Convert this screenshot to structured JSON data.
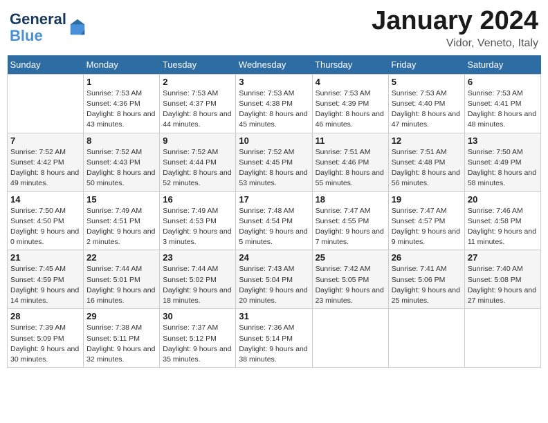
{
  "header": {
    "logo_line1": "General",
    "logo_line2": "Blue",
    "month": "January 2024",
    "location": "Vidor, Veneto, Italy"
  },
  "weekdays": [
    "Sunday",
    "Monday",
    "Tuesday",
    "Wednesday",
    "Thursday",
    "Friday",
    "Saturday"
  ],
  "weeks": [
    [
      {
        "day": "",
        "sunrise": "",
        "sunset": "",
        "daylight": ""
      },
      {
        "day": "1",
        "sunrise": "Sunrise: 7:53 AM",
        "sunset": "Sunset: 4:36 PM",
        "daylight": "Daylight: 8 hours and 43 minutes."
      },
      {
        "day": "2",
        "sunrise": "Sunrise: 7:53 AM",
        "sunset": "Sunset: 4:37 PM",
        "daylight": "Daylight: 8 hours and 44 minutes."
      },
      {
        "day": "3",
        "sunrise": "Sunrise: 7:53 AM",
        "sunset": "Sunset: 4:38 PM",
        "daylight": "Daylight: 8 hours and 45 minutes."
      },
      {
        "day": "4",
        "sunrise": "Sunrise: 7:53 AM",
        "sunset": "Sunset: 4:39 PM",
        "daylight": "Daylight: 8 hours and 46 minutes."
      },
      {
        "day": "5",
        "sunrise": "Sunrise: 7:53 AM",
        "sunset": "Sunset: 4:40 PM",
        "daylight": "Daylight: 8 hours and 47 minutes."
      },
      {
        "day": "6",
        "sunrise": "Sunrise: 7:53 AM",
        "sunset": "Sunset: 4:41 PM",
        "daylight": "Daylight: 8 hours and 48 minutes."
      }
    ],
    [
      {
        "day": "7",
        "sunrise": "Sunrise: 7:52 AM",
        "sunset": "Sunset: 4:42 PM",
        "daylight": "Daylight: 8 hours and 49 minutes."
      },
      {
        "day": "8",
        "sunrise": "Sunrise: 7:52 AM",
        "sunset": "Sunset: 4:43 PM",
        "daylight": "Daylight: 8 hours and 50 minutes."
      },
      {
        "day": "9",
        "sunrise": "Sunrise: 7:52 AM",
        "sunset": "Sunset: 4:44 PM",
        "daylight": "Daylight: 8 hours and 52 minutes."
      },
      {
        "day": "10",
        "sunrise": "Sunrise: 7:52 AM",
        "sunset": "Sunset: 4:45 PM",
        "daylight": "Daylight: 8 hours and 53 minutes."
      },
      {
        "day": "11",
        "sunrise": "Sunrise: 7:51 AM",
        "sunset": "Sunset: 4:46 PM",
        "daylight": "Daylight: 8 hours and 55 minutes."
      },
      {
        "day": "12",
        "sunrise": "Sunrise: 7:51 AM",
        "sunset": "Sunset: 4:48 PM",
        "daylight": "Daylight: 8 hours and 56 minutes."
      },
      {
        "day": "13",
        "sunrise": "Sunrise: 7:50 AM",
        "sunset": "Sunset: 4:49 PM",
        "daylight": "Daylight: 8 hours and 58 minutes."
      }
    ],
    [
      {
        "day": "14",
        "sunrise": "Sunrise: 7:50 AM",
        "sunset": "Sunset: 4:50 PM",
        "daylight": "Daylight: 9 hours and 0 minutes."
      },
      {
        "day": "15",
        "sunrise": "Sunrise: 7:49 AM",
        "sunset": "Sunset: 4:51 PM",
        "daylight": "Daylight: 9 hours and 2 minutes."
      },
      {
        "day": "16",
        "sunrise": "Sunrise: 7:49 AM",
        "sunset": "Sunset: 4:53 PM",
        "daylight": "Daylight: 9 hours and 3 minutes."
      },
      {
        "day": "17",
        "sunrise": "Sunrise: 7:48 AM",
        "sunset": "Sunset: 4:54 PM",
        "daylight": "Daylight: 9 hours and 5 minutes."
      },
      {
        "day": "18",
        "sunrise": "Sunrise: 7:47 AM",
        "sunset": "Sunset: 4:55 PM",
        "daylight": "Daylight: 9 hours and 7 minutes."
      },
      {
        "day": "19",
        "sunrise": "Sunrise: 7:47 AM",
        "sunset": "Sunset: 4:57 PM",
        "daylight": "Daylight: 9 hours and 9 minutes."
      },
      {
        "day": "20",
        "sunrise": "Sunrise: 7:46 AM",
        "sunset": "Sunset: 4:58 PM",
        "daylight": "Daylight: 9 hours and 11 minutes."
      }
    ],
    [
      {
        "day": "21",
        "sunrise": "Sunrise: 7:45 AM",
        "sunset": "Sunset: 4:59 PM",
        "daylight": "Daylight: 9 hours and 14 minutes."
      },
      {
        "day": "22",
        "sunrise": "Sunrise: 7:44 AM",
        "sunset": "Sunset: 5:01 PM",
        "daylight": "Daylight: 9 hours and 16 minutes."
      },
      {
        "day": "23",
        "sunrise": "Sunrise: 7:44 AM",
        "sunset": "Sunset: 5:02 PM",
        "daylight": "Daylight: 9 hours and 18 minutes."
      },
      {
        "day": "24",
        "sunrise": "Sunrise: 7:43 AM",
        "sunset": "Sunset: 5:04 PM",
        "daylight": "Daylight: 9 hours and 20 minutes."
      },
      {
        "day": "25",
        "sunrise": "Sunrise: 7:42 AM",
        "sunset": "Sunset: 5:05 PM",
        "daylight": "Daylight: 9 hours and 23 minutes."
      },
      {
        "day": "26",
        "sunrise": "Sunrise: 7:41 AM",
        "sunset": "Sunset: 5:06 PM",
        "daylight": "Daylight: 9 hours and 25 minutes."
      },
      {
        "day": "27",
        "sunrise": "Sunrise: 7:40 AM",
        "sunset": "Sunset: 5:08 PM",
        "daylight": "Daylight: 9 hours and 27 minutes."
      }
    ],
    [
      {
        "day": "28",
        "sunrise": "Sunrise: 7:39 AM",
        "sunset": "Sunset: 5:09 PM",
        "daylight": "Daylight: 9 hours and 30 minutes."
      },
      {
        "day": "29",
        "sunrise": "Sunrise: 7:38 AM",
        "sunset": "Sunset: 5:11 PM",
        "daylight": "Daylight: 9 hours and 32 minutes."
      },
      {
        "day": "30",
        "sunrise": "Sunrise: 7:37 AM",
        "sunset": "Sunset: 5:12 PM",
        "daylight": "Daylight: 9 hours and 35 minutes."
      },
      {
        "day": "31",
        "sunrise": "Sunrise: 7:36 AM",
        "sunset": "Sunset: 5:14 PM",
        "daylight": "Daylight: 9 hours and 38 minutes."
      },
      {
        "day": "",
        "sunrise": "",
        "sunset": "",
        "daylight": ""
      },
      {
        "day": "",
        "sunrise": "",
        "sunset": "",
        "daylight": ""
      },
      {
        "day": "",
        "sunrise": "",
        "sunset": "",
        "daylight": ""
      }
    ]
  ]
}
